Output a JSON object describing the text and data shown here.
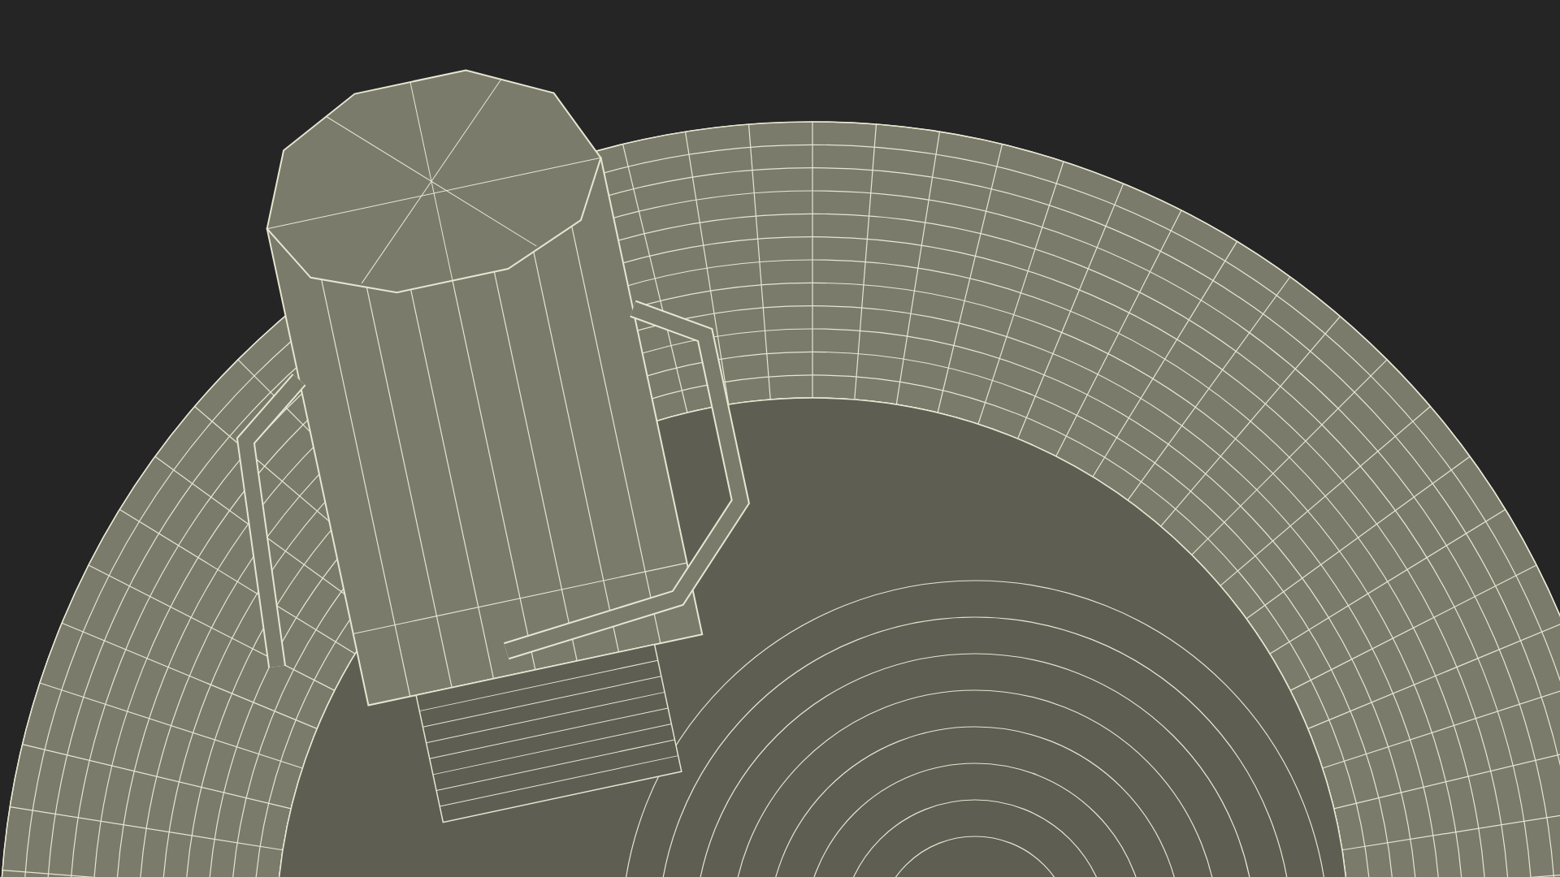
{
  "render": {
    "kind": "wireframe"
  }
}
